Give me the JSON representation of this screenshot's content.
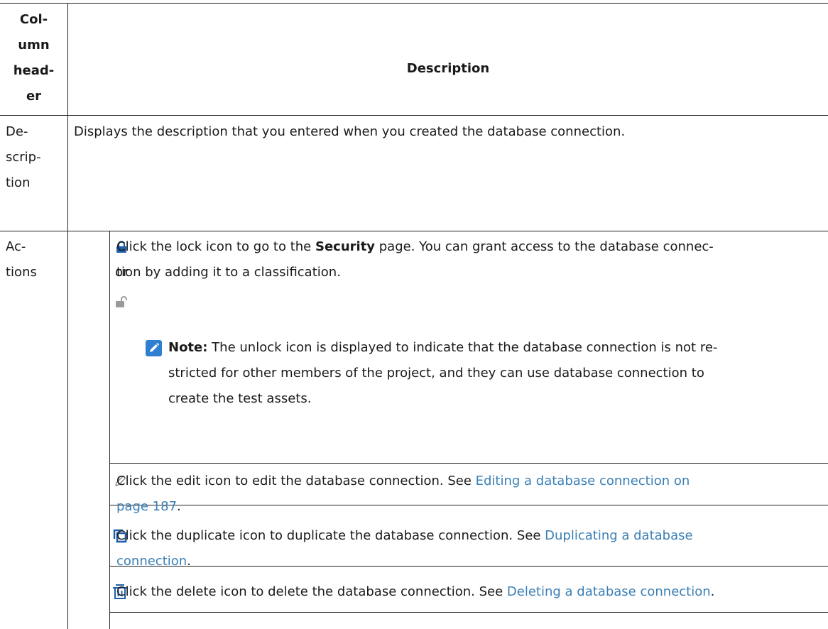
{
  "header": {
    "col_lines": [
      "Col-",
      "umn",
      "head-",
      "er"
    ],
    "description": "Description"
  },
  "row_description": {
    "label_lines": [
      "De-",
      "scrip-",
      "tion"
    ],
    "text": "Displays the description that you entered when you created the database connection."
  },
  "row_actions": {
    "label_lines": [
      "Ac-",
      "tions"
    ],
    "lock": {
      "icon_or": "or",
      "line1_pre": "Click the lock icon to go to the ",
      "line1_bold": "Security",
      "line1_post": " page. You can grant access to the database connec-",
      "line2": "tion by adding it to a classification.",
      "note_label": "Note:",
      "note_line1": " The unlock icon is displayed to indicate that the database connection is not re-",
      "note_line2": "stricted for other members of the project, and they can use database connection to",
      "note_line3": "create the test assets."
    },
    "edit": {
      "line1_pre": "Click the edit icon to edit the database connection. See ",
      "link_part1": "Editing a database connection on",
      "link_part2": "page 187",
      "post": "."
    },
    "duplicate": {
      "line1_pre": "Click the duplicate icon to duplicate the database connection. See ",
      "link_part1": "Duplicating a database",
      "link_part2": "connection",
      "post": "."
    },
    "delete": {
      "line1_pre": "Click the delete icon to delete the database connection. See ",
      "link": "Deleting a database connection",
      "post": "."
    }
  },
  "colors": {
    "link": "#3a7fb5",
    "lock_icon": "#1f5fa8",
    "note_badge": "#2f7fd1",
    "grey_icon": "#9a9a9a"
  },
  "icons": [
    "lock-icon",
    "unlock-icon",
    "note-icon",
    "edit-icon",
    "duplicate-icon",
    "delete-icon"
  ]
}
